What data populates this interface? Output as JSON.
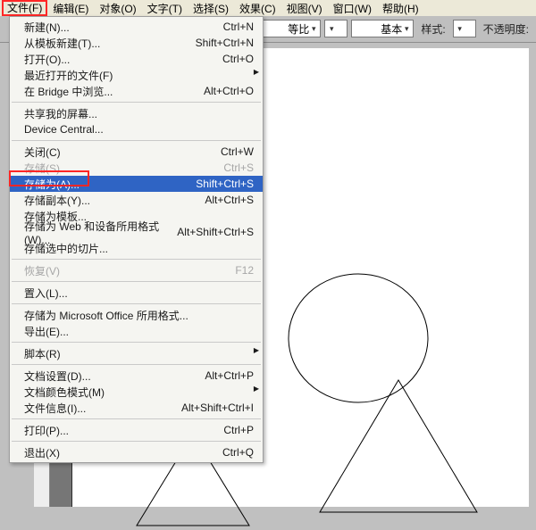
{
  "menubar": {
    "items": [
      {
        "label": "文件(F)"
      },
      {
        "label": "编辑(E)"
      },
      {
        "label": "对象(O)"
      },
      {
        "label": "文字(T)"
      },
      {
        "label": "选择(S)"
      },
      {
        "label": "效果(C)"
      },
      {
        "label": "视图(V)"
      },
      {
        "label": "窗口(W)"
      },
      {
        "label": "帮助(H)"
      }
    ]
  },
  "toolbar": {
    "ratio_label": "等比",
    "basic_label": "基本",
    "style_label": "样式:",
    "opacity_label": "不透明度:"
  },
  "file_menu": {
    "groups": [
      [
        {
          "label": "新建(N)...",
          "shortcut": "Ctrl+N",
          "submenu": false
        },
        {
          "label": "从模板新建(T)...",
          "shortcut": "Shift+Ctrl+N",
          "submenu": false
        },
        {
          "label": "打开(O)...",
          "shortcut": "Ctrl+O",
          "submenu": false
        },
        {
          "label": "最近打开的文件(F)",
          "shortcut": "",
          "submenu": true
        },
        {
          "label": "在 Bridge 中浏览...",
          "shortcut": "Alt+Ctrl+O",
          "submenu": false
        }
      ],
      [
        {
          "label": "共享我的屏幕...",
          "shortcut": "",
          "submenu": false
        },
        {
          "label": "Device Central...",
          "shortcut": "",
          "submenu": false
        }
      ],
      [
        {
          "label": "关闭(C)",
          "shortcut": "Ctrl+W",
          "submenu": false
        },
        {
          "label": "存储(S)",
          "shortcut": "Ctrl+S",
          "submenu": false,
          "disabled": true
        },
        {
          "label": "存储为(A)...",
          "shortcut": "Shift+Ctrl+S",
          "submenu": false,
          "selected": true
        },
        {
          "label": "存储副本(Y)...",
          "shortcut": "Alt+Ctrl+S",
          "submenu": false
        },
        {
          "label": "存储为模板...",
          "shortcut": "",
          "submenu": false
        },
        {
          "label": "存储为 Web 和设备所用格式(W)...",
          "shortcut": "Alt+Shift+Ctrl+S",
          "submenu": false
        },
        {
          "label": "存储选中的切片...",
          "shortcut": "",
          "submenu": false
        }
      ],
      [
        {
          "label": "恢复(V)",
          "shortcut": "F12",
          "submenu": false,
          "disabled": true
        }
      ],
      [
        {
          "label": "置入(L)...",
          "shortcut": "",
          "submenu": false
        }
      ],
      [
        {
          "label": "存储为 Microsoft Office 所用格式...",
          "shortcut": "",
          "submenu": false
        },
        {
          "label": "导出(E)...",
          "shortcut": "",
          "submenu": false
        }
      ],
      [
        {
          "label": "脚本(R)",
          "shortcut": "",
          "submenu": true
        }
      ],
      [
        {
          "label": "文档设置(D)...",
          "shortcut": "Alt+Ctrl+P",
          "submenu": false
        },
        {
          "label": "文档颜色模式(M)",
          "shortcut": "",
          "submenu": true
        },
        {
          "label": "文件信息(I)...",
          "shortcut": "Alt+Shift+Ctrl+I",
          "submenu": false
        }
      ],
      [
        {
          "label": "打印(P)...",
          "shortcut": "Ctrl+P",
          "submenu": false
        }
      ],
      [
        {
          "label": "退出(X)",
          "shortcut": "Ctrl+Q",
          "submenu": false
        }
      ]
    ]
  }
}
